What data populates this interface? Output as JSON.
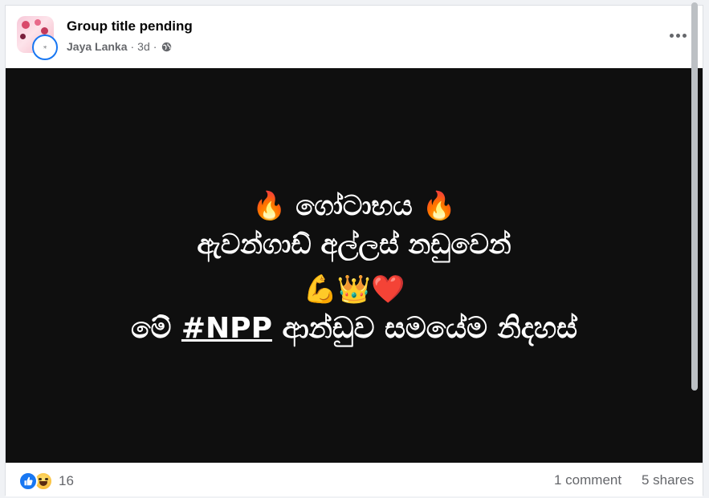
{
  "post": {
    "group_title": "Group title pending",
    "author": "Jaya Lanka",
    "separator": "·",
    "time": "3d",
    "privacy_icon": "globe-icon",
    "more_icon": "more-horizontal-icon"
  },
  "media": {
    "line1": "🔥 ගෝටාභය 🔥",
    "line2": "ඇවන්ගාඩ් අල්ලස් නඩුවෙන්",
    "line3": "💪👑❤️",
    "line4_prefix": "මේ ",
    "line4_hashtag": "#NPP",
    "line4_suffix": " ආන්ඩුව සමයේම නිදහස්",
    "background": "#0f0f0f",
    "text_color": "#ffffff"
  },
  "footer": {
    "reaction_icons": [
      "like-icon",
      "haha-icon"
    ],
    "reaction_count": "16",
    "comments": "1 comment",
    "shares": "5 shares"
  },
  "colors": {
    "accent": "#1877f2",
    "secondary_text": "#65676b"
  }
}
